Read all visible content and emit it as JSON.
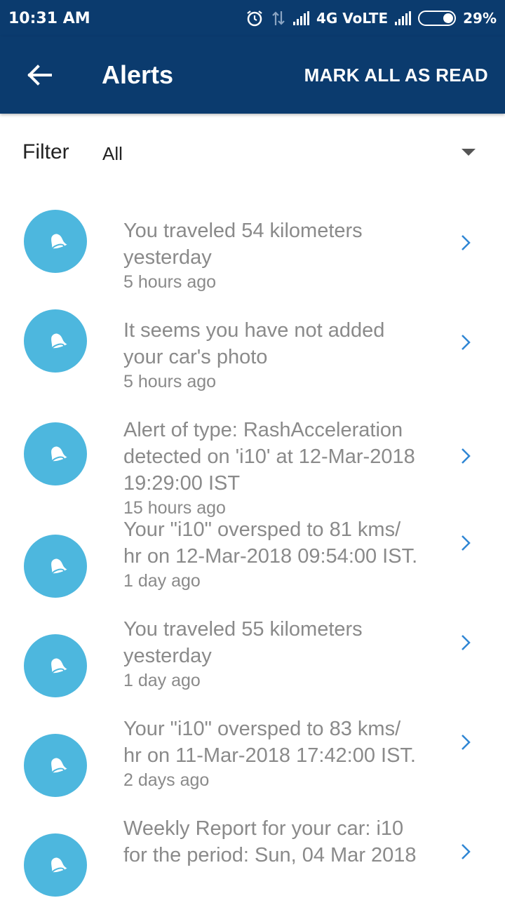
{
  "status_bar": {
    "time": "10:31 AM",
    "network": "4G VoLTE",
    "battery": "29%"
  },
  "app_bar": {
    "title": "Alerts",
    "action": "MARK ALL AS READ"
  },
  "filter": {
    "label": "Filter",
    "value": "All"
  },
  "colors": {
    "primary": "#0b3b6e",
    "avatar": "#4db7de",
    "chevron": "#2f86d4",
    "text": "#8a8a8a"
  },
  "alerts": [
    {
      "lines": [
        "You traveled 54 kilometers",
        "yesterday"
      ],
      "time": "5 hours ago"
    },
    {
      "lines": [
        "It seems you have not added",
        "your car's photo"
      ],
      "time": "5 hours ago"
    },
    {
      "lines": [
        "Alert of type: RashAcceleration",
        "detected on 'i10' at 12-Mar-2018",
        "19:29:00 IST"
      ],
      "time": "15 hours ago"
    },
    {
      "lines": [
        "Your \"i10\" oversped to 81 kms/",
        "hr on 12-Mar-2018 09:54:00 IST."
      ],
      "time": "1 day ago"
    },
    {
      "lines": [
        "You traveled 55 kilometers",
        "yesterday"
      ],
      "time": "1 day ago"
    },
    {
      "lines": [
        "Your \"i10\" oversped to 83 kms/",
        "hr on 11-Mar-2018 17:42:00 IST."
      ],
      "time": "2 days ago"
    },
    {
      "lines": [
        "Weekly Report for your car: i10",
        "for the period: Sun, 04 Mar 2018"
      ],
      "time": ""
    }
  ]
}
